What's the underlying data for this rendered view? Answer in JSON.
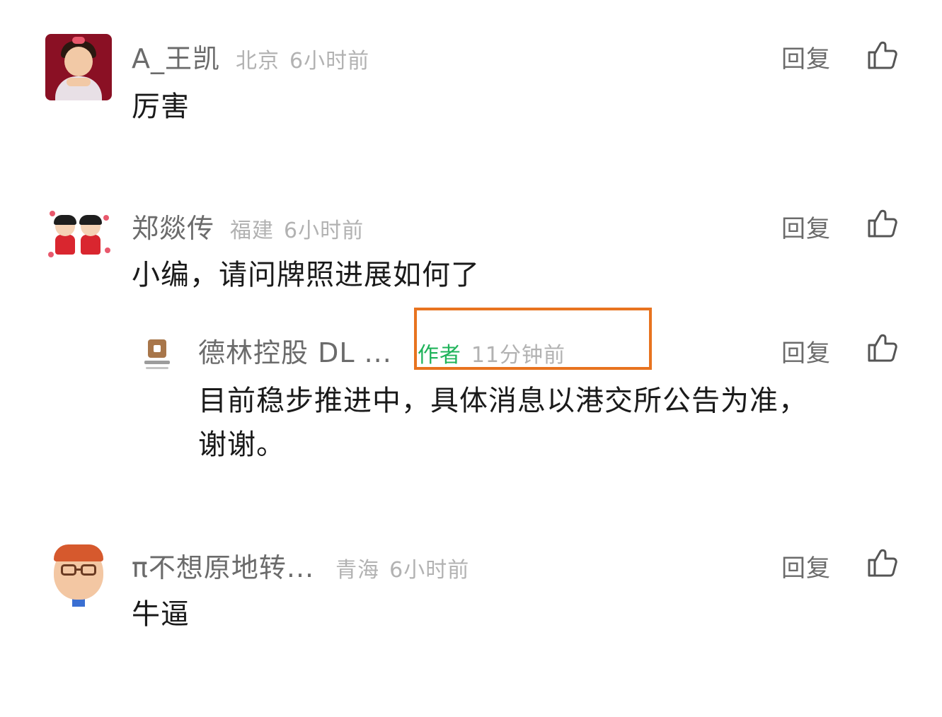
{
  "reply_label": "回复",
  "accent": {
    "author_green": "#1fb35a",
    "highlight_orange": "#e8731f"
  },
  "comments": [
    {
      "username": "A_王凯",
      "location": "北京",
      "time": "6小时前",
      "text": "厉害",
      "avatar": "girl-avatar"
    },
    {
      "username": "郑燚传",
      "location": "福建",
      "time": "6小时前",
      "text": "小编，请问牌照进展如何了",
      "avatar": "two-kids-avatar"
    },
    {
      "username": "德林控股 DL ...",
      "author_tag": "作者",
      "time": "11分钟前",
      "text_line1": "目前稳步推进中，具体消息以港交所公告为准，",
      "text_line2": "谢谢。",
      "avatar": "company-logo-avatar",
      "is_reply": true
    },
    {
      "username": "π不想原地转...",
      "location": "青海",
      "time": "6小时前",
      "text": "牛逼",
      "avatar": "cartoon-man-avatar"
    }
  ]
}
